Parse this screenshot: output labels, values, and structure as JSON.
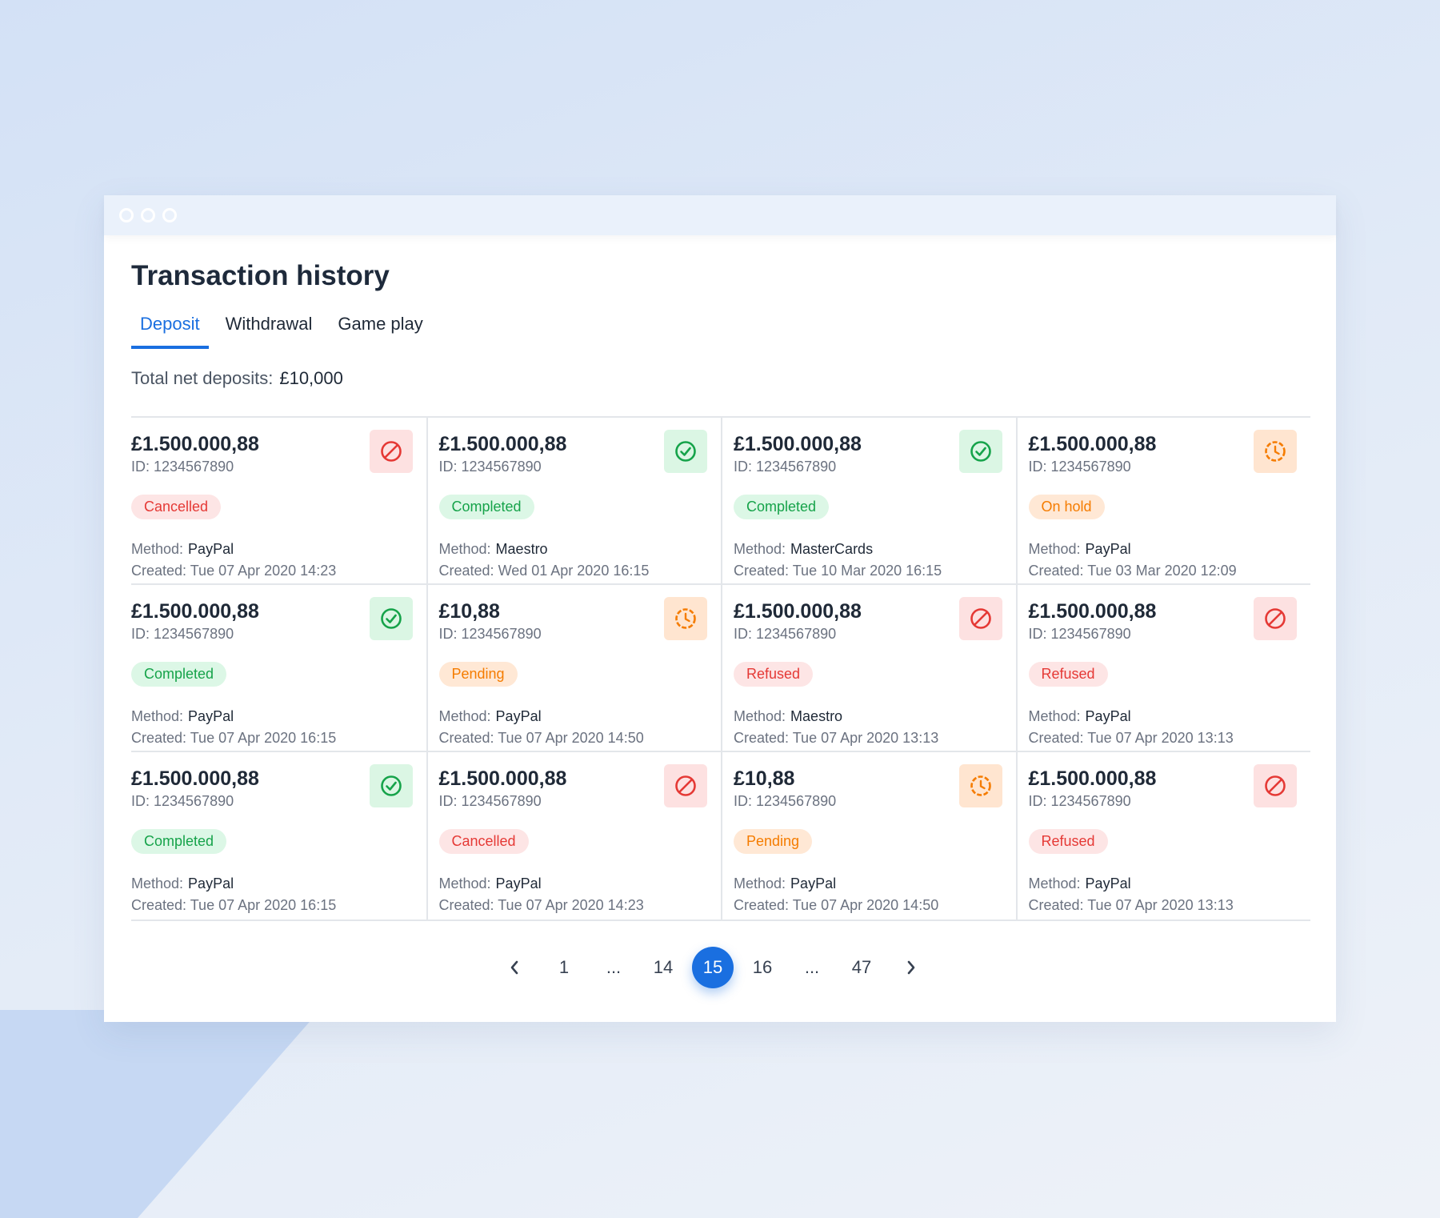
{
  "window": {
    "title": "Transaction history"
  },
  "tabs": [
    {
      "label": "Deposit",
      "active": true
    },
    {
      "label": "Withdrawal",
      "active": false
    },
    {
      "label": "Game play",
      "active": false
    }
  ],
  "summary": {
    "label": "Total net deposits:",
    "value": "£10,000"
  },
  "method_label": "Method:",
  "created_label": "Created:",
  "transactions": [
    {
      "amount": "£1.500.000,88",
      "id": "ID: 1234567890",
      "status": "Cancelled",
      "status_key": "cancelled",
      "icon": "block-icon",
      "method": "PayPal",
      "created": "Tue 07 Apr 2020 14:23"
    },
    {
      "amount": "£1.500.000,88",
      "id": "ID: 1234567890",
      "status": "Completed",
      "status_key": "completed",
      "icon": "check-circle-icon",
      "method": "Maestro",
      "created": "Wed 01 Apr 2020 16:15"
    },
    {
      "amount": "£1.500.000,88",
      "id": "ID: 1234567890",
      "status": "Completed",
      "status_key": "completed",
      "icon": "check-circle-icon",
      "method": "MasterCards",
      "created": "Tue 10 Mar 2020 16:15"
    },
    {
      "amount": "£1.500.000,88",
      "id": "ID: 1234567890",
      "status": "On hold",
      "status_key": "onhold",
      "icon": "clock-icon",
      "method": "PayPal",
      "created": "Tue 03 Mar 2020 12:09"
    },
    {
      "amount": "£1.500.000,88",
      "id": "ID: 1234567890",
      "status": "Completed",
      "status_key": "completed",
      "icon": "check-circle-icon",
      "method": "PayPal",
      "created": "Tue 07 Apr 2020 16:15"
    },
    {
      "amount": "£10,88",
      "id": "ID: 1234567890",
      "status": "Pending",
      "status_key": "pending",
      "icon": "clock-icon",
      "method": "PayPal",
      "created": "Tue 07 Apr 2020 14:50"
    },
    {
      "amount": "£1.500.000,88",
      "id": "ID: 1234567890",
      "status": "Refused",
      "status_key": "refused",
      "icon": "block-icon",
      "method": "Maestro",
      "created": "Tue 07 Apr 2020 13:13"
    },
    {
      "amount": "£1.500.000,88",
      "id": "ID: 1234567890",
      "status": "Refused",
      "status_key": "refused",
      "icon": "block-icon",
      "method": "PayPal",
      "created": "Tue 07 Apr 2020 13:13"
    },
    {
      "amount": "£1.500.000,88",
      "id": "ID: 1234567890",
      "status": "Completed",
      "status_key": "completed",
      "icon": "check-circle-icon",
      "method": "PayPal",
      "created": "Tue 07 Apr 2020 16:15"
    },
    {
      "amount": "£1.500.000,88",
      "id": "ID: 1234567890",
      "status": "Cancelled",
      "status_key": "cancelled",
      "icon": "block-icon",
      "method": "PayPal",
      "created": "Tue 07 Apr 2020 14:23"
    },
    {
      "amount": "£10,88",
      "id": "ID: 1234567890",
      "status": "Pending",
      "status_key": "pending",
      "icon": "clock-icon",
      "method": "PayPal",
      "created": "Tue 07 Apr 2020 14:50"
    },
    {
      "amount": "£1.500.000,88",
      "id": "ID: 1234567890",
      "status": "Refused",
      "status_key": "refused",
      "icon": "block-icon",
      "method": "PayPal",
      "created": "Tue 07 Apr 2020 13:13"
    }
  ],
  "pagination": {
    "pages": [
      "1",
      "...",
      "14",
      "15",
      "16",
      "...",
      "47"
    ],
    "current": "15"
  },
  "colors": {
    "accent": "#1a6fe0",
    "success": "#16a34a",
    "danger": "#e53935",
    "warning": "#f57c00"
  }
}
